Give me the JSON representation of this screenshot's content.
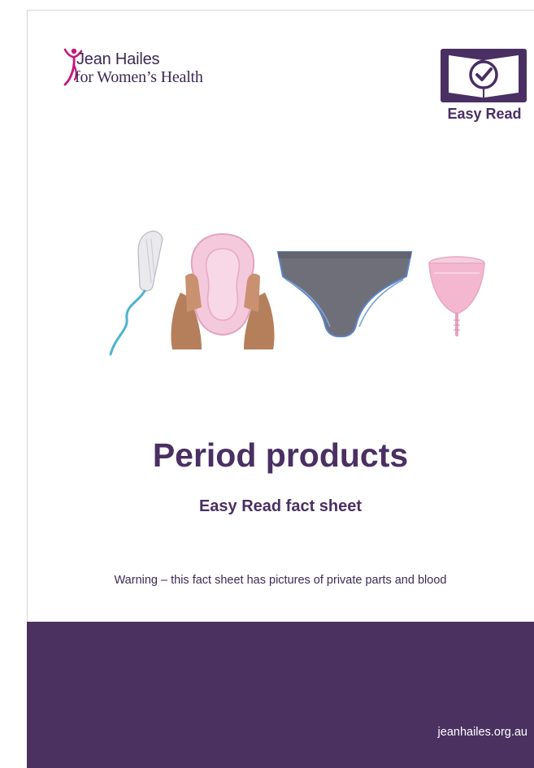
{
  "logo": {
    "line1": "Jean Hailes",
    "line2": "for Women’s Health"
  },
  "badge": {
    "label": "Easy Read",
    "icon": "book-check-icon"
  },
  "illustration": {
    "items": [
      "tampon",
      "pad",
      "period-underwear",
      "menstrual-cup"
    ]
  },
  "title": "Period products",
  "subtitle": "Easy Read fact sheet",
  "warning": "Warning – this fact sheet has pictures of private parts and blood",
  "footer": {
    "url": "jeanhailes.org.au"
  },
  "colors": {
    "brand_purple": "#4b3160",
    "logo_magenta": "#c2187a",
    "text_purple": "#4a2f63"
  }
}
